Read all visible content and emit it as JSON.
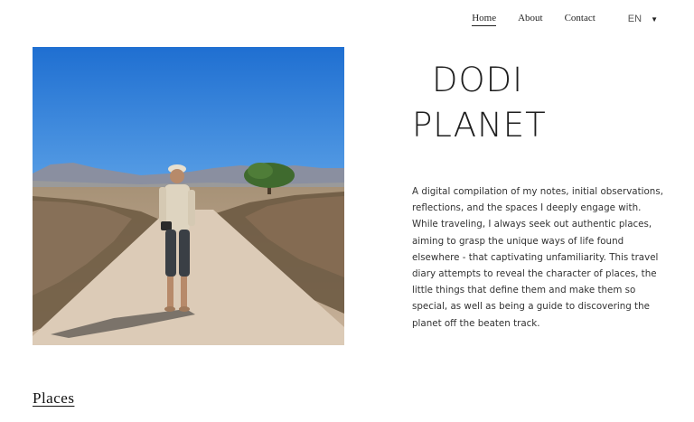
{
  "nav": {
    "items": [
      {
        "label": "Home",
        "active": true
      },
      {
        "label": "About",
        "active": false
      },
      {
        "label": "Contact",
        "active": false
      }
    ],
    "language": {
      "label": "EN",
      "icon": "caret-down-icon"
    }
  },
  "hero": {
    "title_line1": "DODI",
    "title_line2": "PLANET",
    "intro": "A digital compilation of my notes, initial observations, reflections, and the spaces I deeply engage with. While traveling, I always seek out authentic places, aiming to grasp the unique ways of life found elsewhere - that captivating unfamiliarity. This travel diary attempts to reveal the character of places, the little things that define them and make them so special, as well as being a guide to discovering the planet off the beaten track."
  },
  "sections": {
    "places_heading": "Places"
  },
  "colors": {
    "text": "#222222",
    "sky": "#2f7fd6",
    "road": "#d8c7b3"
  }
}
